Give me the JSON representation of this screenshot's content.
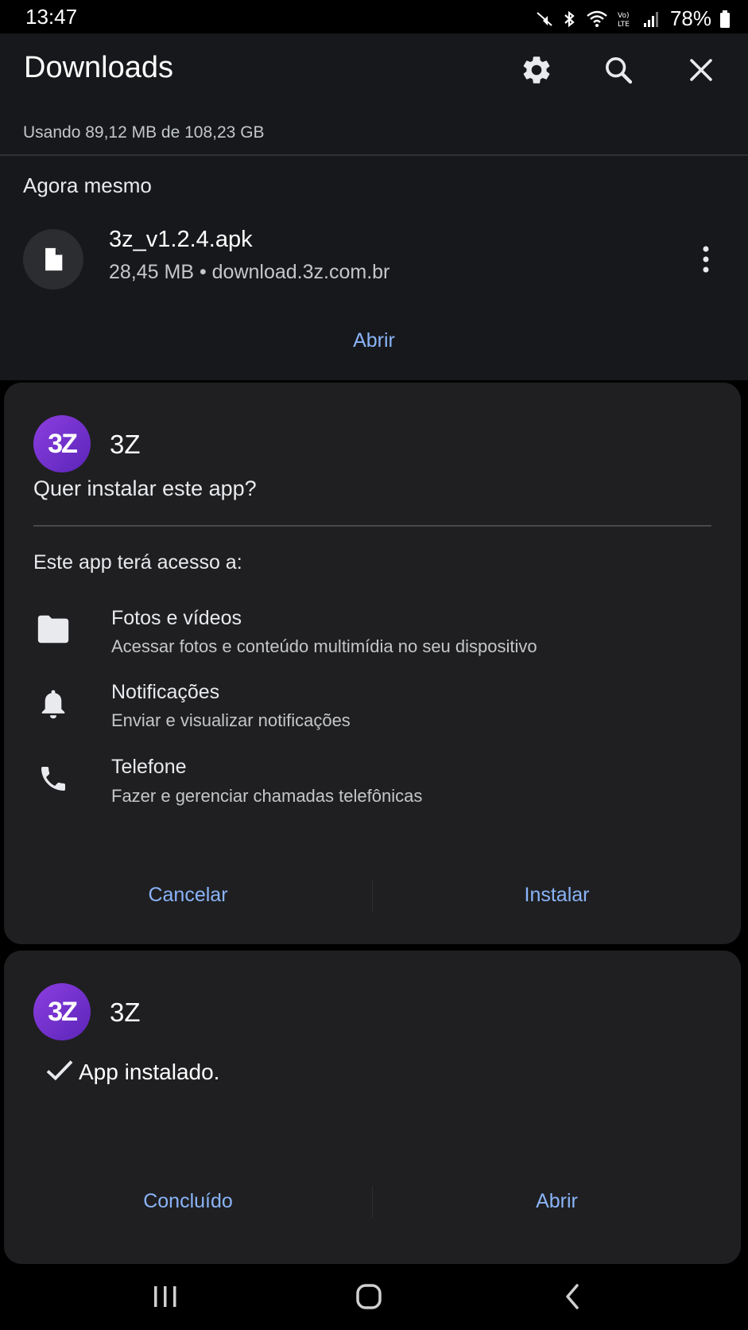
{
  "status_bar": {
    "time": "13:47",
    "battery_percent": "78%",
    "icons": [
      "mute-icon",
      "bluetooth-icon",
      "wifi-icon",
      "volte-icon",
      "signal-icon",
      "battery-icon"
    ]
  },
  "downloads": {
    "title": "Downloads",
    "usage": "Usando 89,12 MB de 108,23 GB",
    "section": "Agora mesmo",
    "item": {
      "name": "3z_v1.2.4.apk",
      "meta": "28,45 MB • download.3z.com.br"
    },
    "open_label": "Abrir"
  },
  "install_dialog": {
    "app_logo_text": "3Z",
    "app_name": "3Z",
    "question": "Quer instalar este app?",
    "access_title": "Este app terá acesso a:",
    "permissions": [
      {
        "icon": "folder-icon",
        "title": "Fotos e vídeos",
        "desc": "Acessar fotos e conteúdo multimídia no seu dispositivo"
      },
      {
        "icon": "bell-icon",
        "title": "Notificações",
        "desc": "Enviar e visualizar notificações"
      },
      {
        "icon": "phone-icon",
        "title": "Telefone",
        "desc": "Fazer e gerenciar chamadas telefônicas"
      }
    ],
    "cancel_label": "Cancelar",
    "install_label": "Instalar"
  },
  "installed_dialog": {
    "app_logo_text": "3Z",
    "app_name": "3Z",
    "message": "App instalado.",
    "done_label": "Concluído",
    "open_label": "Abrir"
  },
  "colors": {
    "accent": "#8ab4f8",
    "background": "#17181b",
    "dialog": "#1f1f21",
    "logo_start": "#8c3ee0",
    "logo_end": "#5b25b8"
  }
}
